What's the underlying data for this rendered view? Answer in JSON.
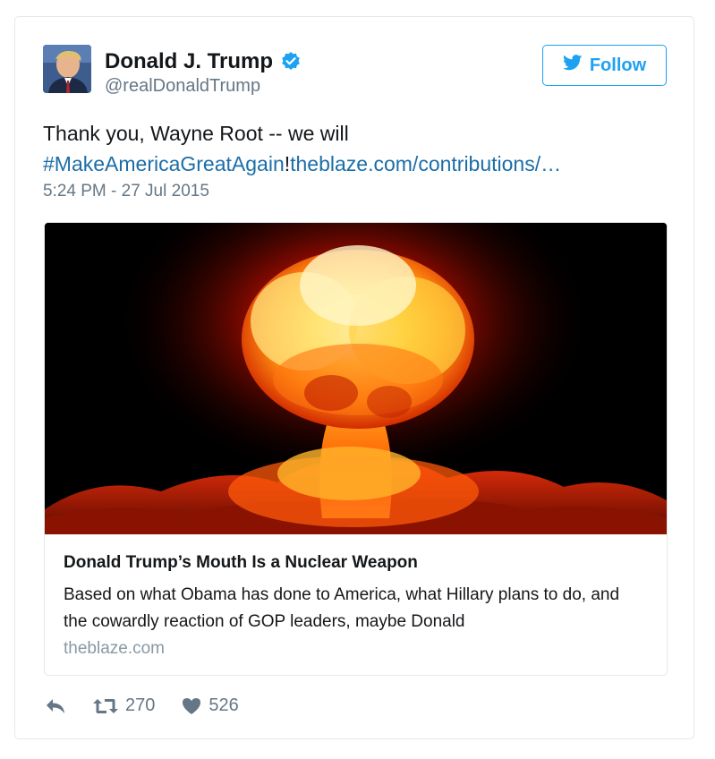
{
  "author": {
    "name": "Donald J. Trump",
    "handle": "@realDonaldTrump",
    "verified": true
  },
  "follow_button": {
    "label": "Follow",
    "icon": "twitter-bird-icon"
  },
  "tweet": {
    "text_prefix": "Thank you, Wayne Root -- we will",
    "hashtag": "#MakeAmericaGreatAgain",
    "separator": "!",
    "link": "theblaze.com/contributions/…",
    "timestamp": "5:24 PM - 27 Jul 2015"
  },
  "card": {
    "title": "Donald Trump’s Mouth Is a Nuclear Weapon",
    "description": "Based on what Obama has done to America, what Hillary plans to do, and the cowardly reaction of GOP leaders, maybe Donald",
    "domain": "theblaze.com",
    "image": "nuclear-explosion-mushroom-cloud"
  },
  "actions": {
    "reply_icon": "reply-icon",
    "retweet_icon": "retweet-icon",
    "retweet_count": "270",
    "like_icon": "heart-icon",
    "like_count": "526"
  },
  "colors": {
    "link": "#1b6ea8",
    "brand_blue": "#1da1f2",
    "secondary_text": "#657786",
    "domain_text": "#8899a6",
    "border": "#e1e8ed"
  }
}
